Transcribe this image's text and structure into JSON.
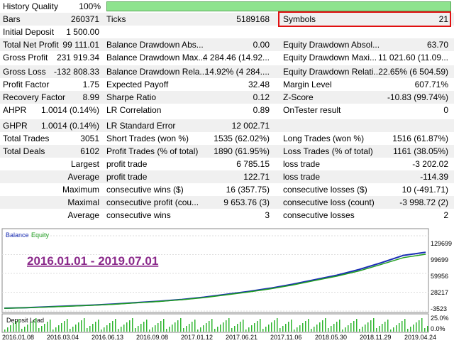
{
  "history_quality": {
    "label": "History Quality",
    "value": "100%"
  },
  "rows": [
    {
      "c1l": "Bars",
      "c1v": "260371",
      "c2l": "Ticks",
      "c2v": "5189168",
      "c3l": "Symbols",
      "c3v": "21"
    },
    {
      "c1l": "Initial Deposit",
      "c1v": "1 500.00",
      "c2l": "",
      "c2v": "",
      "c3l": "",
      "c3v": ""
    },
    {
      "c1l": "Total Net Profit",
      "c1v": "99 111.01",
      "c2l": "Balance Drawdown Abs...",
      "c2v": "0.00",
      "c3l": "Equity Drawdown Absol...",
      "c3v": "63.70"
    },
    {
      "c1l": "Gross Profit",
      "c1v": "231 919.34",
      "c2l": "Balance Drawdown Max...",
      "c2v": "4 284.46 (14.92...",
      "c3l": "Equity Drawdown Maxi...",
      "c3v": "11 021.60 (11.09..."
    },
    {
      "c1l": "Gross Loss",
      "c1v": "-132 808.33",
      "c2l": "Balance Drawdown Rela...",
      "c2v": "14.92% (4 284....",
      "c3l": "Equity Drawdown Relati...",
      "c3v": "22.65% (6 504.59)"
    },
    {
      "c1l": "Profit Factor",
      "c1v": "1.75",
      "c2l": "Expected Payoff",
      "c2v": "32.48",
      "c3l": "Margin Level",
      "c3v": "607.71%"
    },
    {
      "c1l": "Recovery Factor",
      "c1v": "8.99",
      "c2l": "Sharpe Ratio",
      "c2v": "0.12",
      "c3l": "Z-Score",
      "c3v": "-10.83 (99.74%)"
    },
    {
      "c1l": "AHPR",
      "c1v": "1.0014 (0.14%)",
      "c2l": "LR Correlation",
      "c2v": "0.89",
      "c3l": "OnTester result",
      "c3v": "0"
    },
    {
      "c1l": "GHPR",
      "c1v": "1.0014 (0.14%)",
      "c2l": "LR Standard Error",
      "c2v": "12 002.71",
      "c3l": "",
      "c3v": ""
    },
    {
      "c1l": "Total Trades",
      "c1v": "3051",
      "c2l": "Short Trades (won %)",
      "c2v": "1535 (62.02%)",
      "c3l": "Long Trades (won %)",
      "c3v": "1516 (61.87%)"
    },
    {
      "c1l": "Total Deals",
      "c1v": "6102",
      "c2l": "Profit Trades (% of total)",
      "c2v": "1890 (61.95%)",
      "c3l": "Loss Trades (% of total)",
      "c3v": "1161 (38.05%)"
    },
    {
      "c1l": "Largest",
      "c1v": "",
      "c2l": "profit trade",
      "c2v": "6 785.15",
      "c3l": "loss trade",
      "c3v": "-3 202.02"
    },
    {
      "c1l": "Average",
      "c1v": "",
      "c2l": "profit trade",
      "c2v": "122.71",
      "c3l": "loss trade",
      "c3v": "-114.39"
    },
    {
      "c1l": "Maximum",
      "c1v": "",
      "c2l": "consecutive wins ($)",
      "c2v": "16 (357.75)",
      "c3l": "consecutive losses ($)",
      "c3v": "10 (-491.71)"
    },
    {
      "c1l": "Maximal",
      "c1v": "",
      "c2l": "consecutive profit (cou...",
      "c2v": "9 653.76 (3)",
      "c3l": "consecutive loss (count)",
      "c3v": "-3 998.72 (2)"
    },
    {
      "c1l": "Average",
      "c1v": "",
      "c2l": "consecutive wins",
      "c2v": "3",
      "c3l": "consecutive losses",
      "c3v": "2"
    }
  ],
  "chart_data": {
    "type": "line",
    "legend": [
      "Balance",
      "Equity"
    ],
    "annotation": "2016.01.01 - 2019.07.01",
    "y_ticks": [
      "129699",
      "99699",
      "59956",
      "28217",
      "-3523"
    ],
    "deposit_load_label": "Deposit Load",
    "deposit_load_ticks": [
      "25.0%",
      "0.0%"
    ],
    "x_ticks": [
      "2016.01.08",
      "2016.03.04",
      "2016.06.13",
      "2016.09.08",
      "2017.01.12",
      "2017.06.21",
      "2017.11.06",
      "2018.05.30",
      "2018.11.29",
      "2019.04.24"
    ],
    "series": [
      {
        "name": "Balance",
        "color": "#1b2fb5",
        "values": [
          1500,
          2500,
          4000,
          5500,
          7000,
          9000,
          11500,
          14000,
          17000,
          21000,
          26000,
          31000,
          37000,
          44000,
          52000,
          60000,
          70000,
          82000,
          95000,
          100600
        ]
      },
      {
        "name": "Equity",
        "color": "#1f9e1f",
        "values": [
          1400,
          2300,
          3800,
          5200,
          6700,
          8600,
          11000,
          13500,
          16400,
          20200,
          25100,
          30000,
          35800,
          42500,
          50500,
          58200,
          67500,
          79000,
          91000,
          97000
        ]
      }
    ]
  }
}
